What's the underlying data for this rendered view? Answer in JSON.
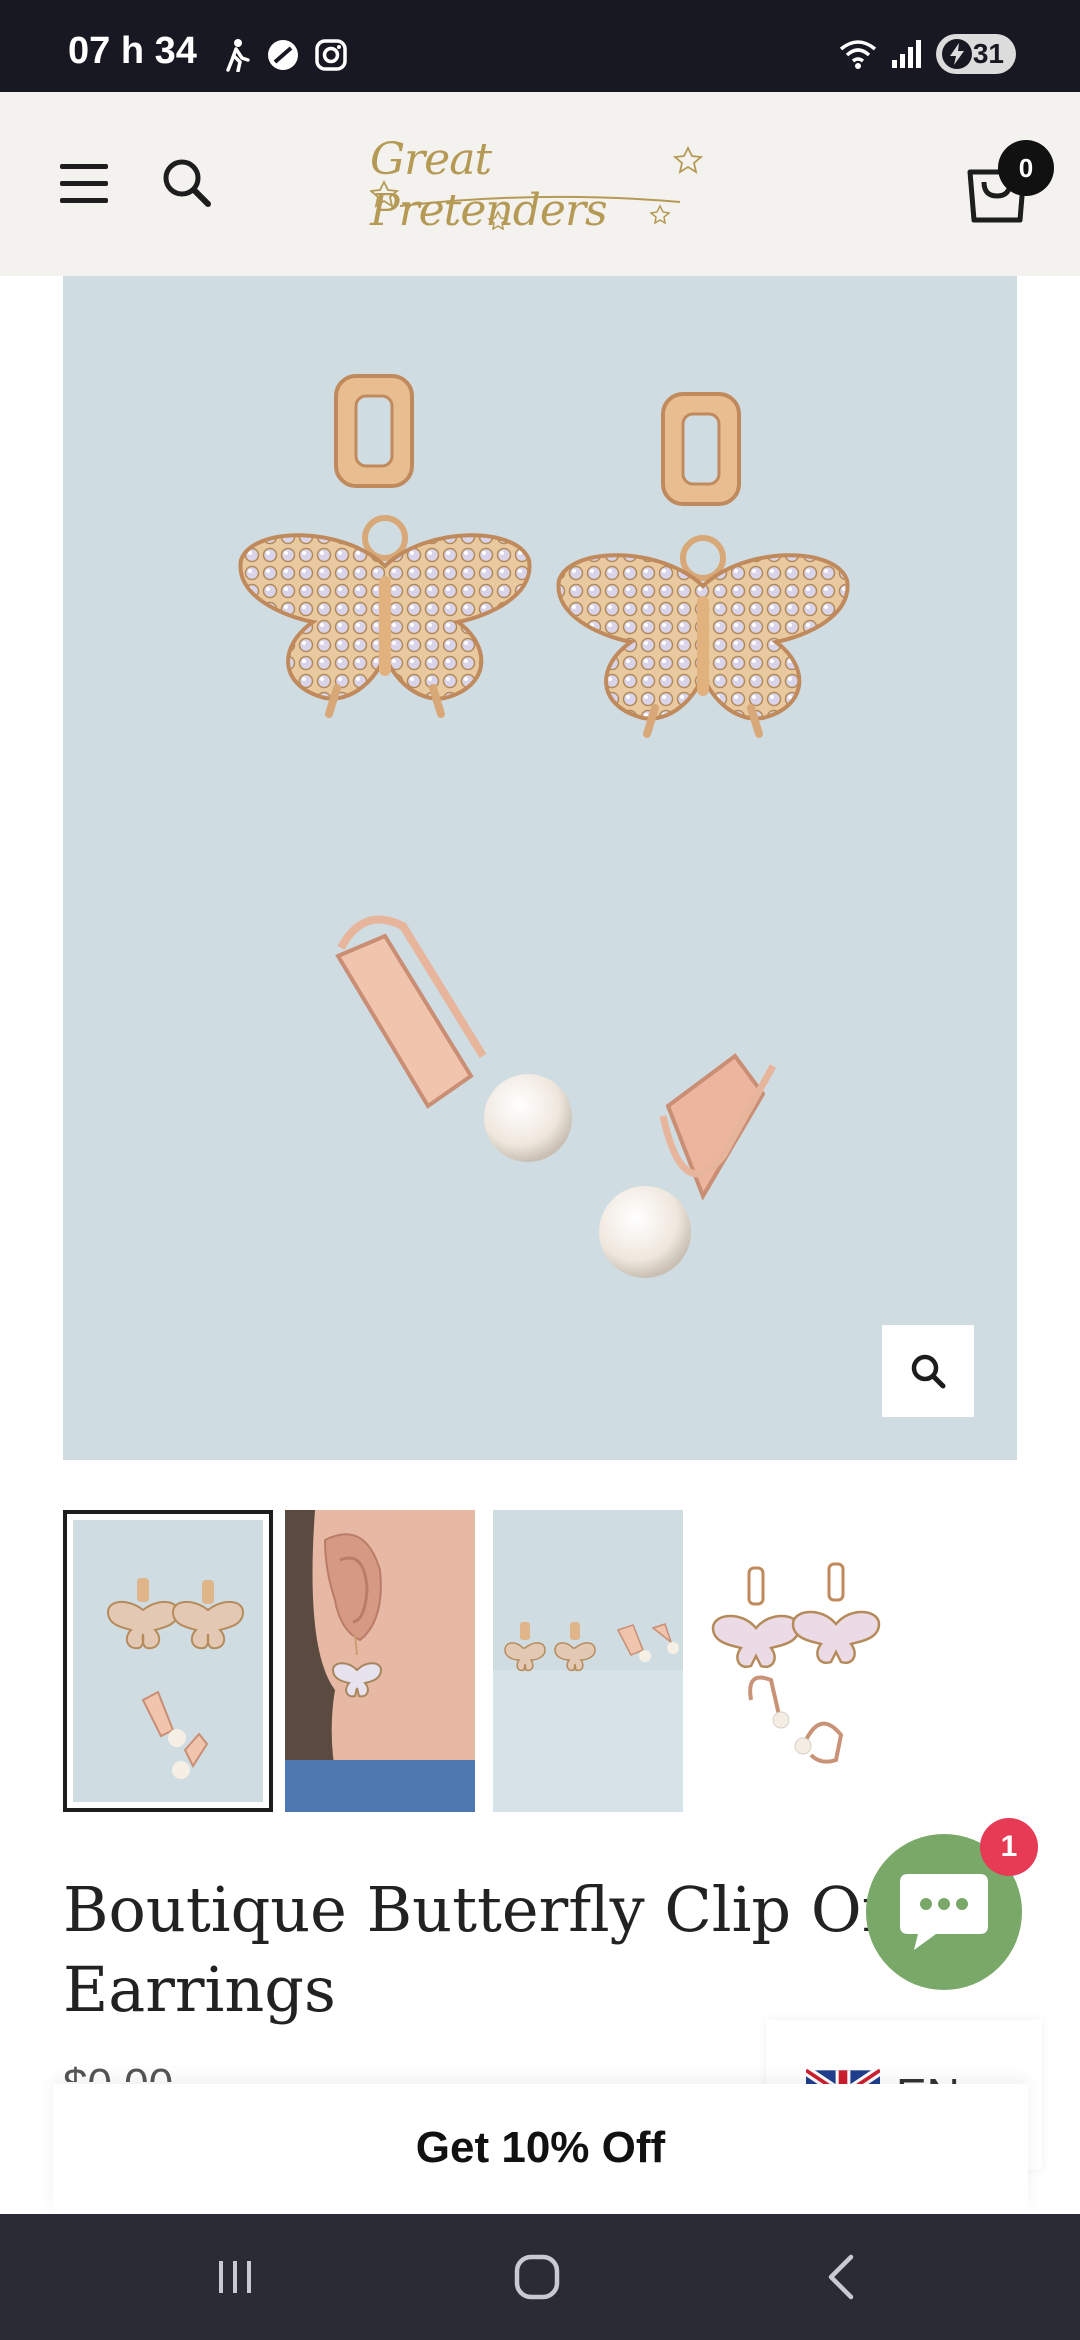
{
  "status_bar": {
    "time": "07 h 34",
    "battery": "31",
    "icons": [
      "walking-icon",
      "no-disturb-icon",
      "instagram-icon",
      "wifi-icon",
      "signal-icon",
      "battery-icon"
    ]
  },
  "header": {
    "logo_text": "Great Pretenders",
    "cart_count": "0",
    "icons": [
      "menu-icon",
      "search-icon",
      "cart-icon"
    ]
  },
  "product": {
    "title": "Boutique Butterfly Clip On Earrings",
    "price_peek": "$0.00",
    "thumbnails": [
      "thumbnail-1",
      "thumbnail-2",
      "thumbnail-3",
      "thumbnail-4"
    ],
    "zoom_icon": "zoom-icon"
  },
  "chat": {
    "badge": "1",
    "icon": "chat-icon"
  },
  "language": {
    "code": "EN",
    "flag": "uk-flag-icon"
  },
  "discount": {
    "label": "Get 10% Off"
  },
  "nav": [
    "recent-apps-icon",
    "home-icon",
    "back-icon"
  ],
  "colors": {
    "status_bg": "#171821",
    "header_bg": "#f4f2ee",
    "image_bg": "#cfdde3",
    "logo_gold": "#b59a55",
    "chat_green": "#79a869",
    "badge_red": "#e63a55",
    "nav_bg": "#2a2b35"
  }
}
